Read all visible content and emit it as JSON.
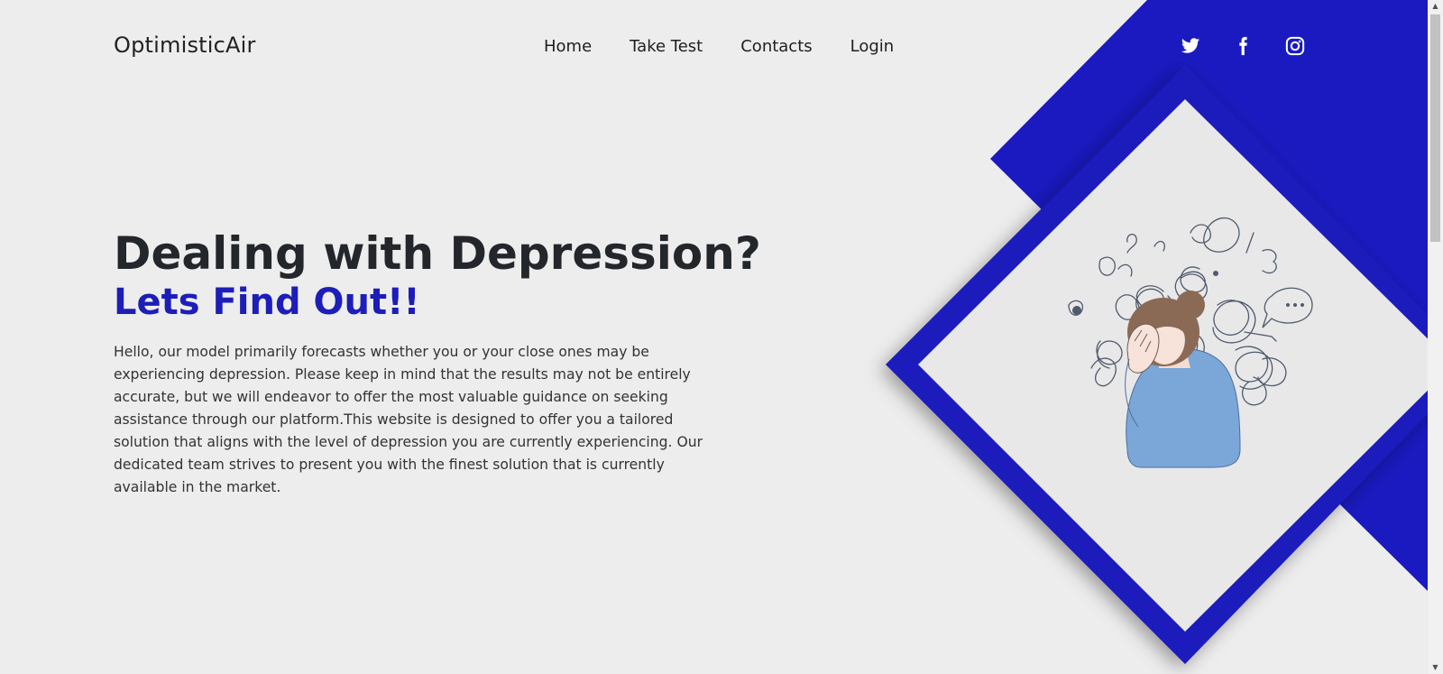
{
  "header": {
    "logo": "OptimisticAir",
    "nav": [
      {
        "label": "Home"
      },
      {
        "label": "Take Test"
      },
      {
        "label": "Contacts"
      },
      {
        "label": "Login"
      }
    ],
    "social": [
      "twitter-icon",
      "facebook-icon",
      "instagram-icon"
    ]
  },
  "hero": {
    "title": "Dealing with Depression?",
    "subtitle": "Lets Find Out!!",
    "description": "Hello, our model primarily forecasts whether you or your close ones may be experiencing depression. Please keep in mind that the results may not be entirely accurate, but we will endeavor to offer the most valuable guidance on seeking assistance through our platform.This website is designed to offer you a tailored solution that aligns with the level of depression you are currently experiencing. Our dedicated team strives to present you with the finest solution that is currently available in the market."
  },
  "illustration": "person-holding-head-with-tangled-thoughts",
  "colors": {
    "accent": "#1d1dba",
    "background": "#ededed",
    "text": "#23262b"
  }
}
